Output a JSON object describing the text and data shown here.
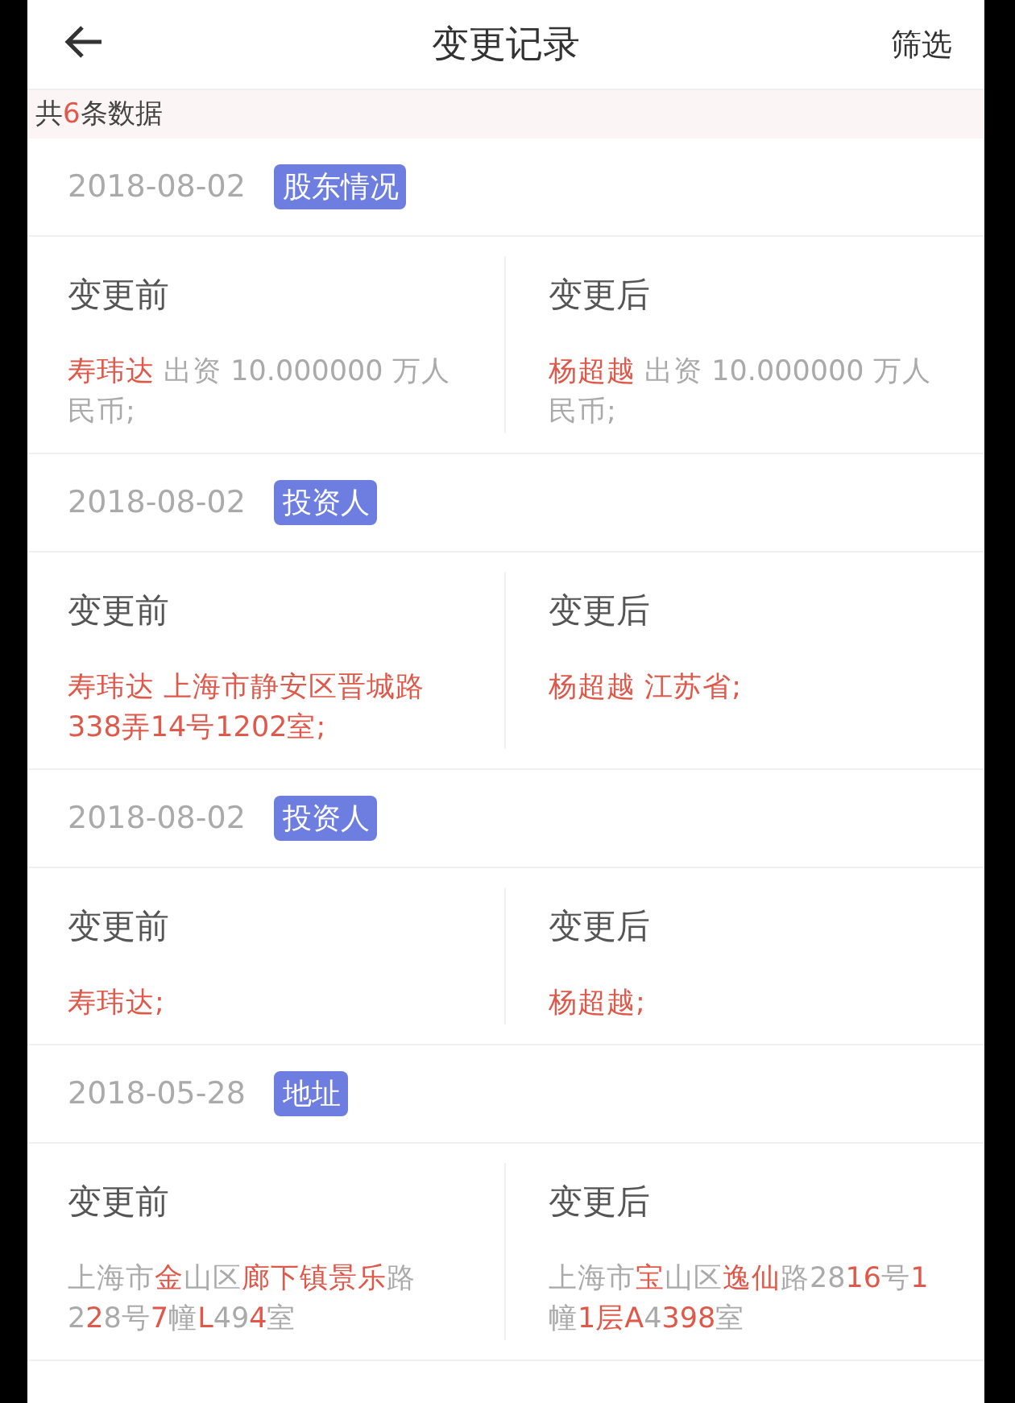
{
  "header": {
    "back_icon": true,
    "title": "变更记录",
    "filter": "筛选"
  },
  "count": [
    {
      "text": "共",
      "highlight": false
    },
    {
      "text": "6",
      "highlight": true
    },
    {
      "text": "条数据",
      "highlight": false
    }
  ],
  "records": [
    {
      "date": "2018-08-02",
      "tag": "股东情况",
      "before_label": "变更前",
      "after_label": "变更后",
      "before": [
        {
          "text": "寿玮达",
          "highlight": true
        },
        {
          "text": " 出资 10.000000 万人民币;",
          "highlight": false
        }
      ],
      "after": [
        {
          "text": "杨超越",
          "highlight": true
        },
        {
          "text": " 出资 10.000000 万人民币;",
          "highlight": false
        }
      ]
    },
    {
      "date": "2018-08-02",
      "tag": "投资人",
      "before_label": "变更前",
      "after_label": "变更后",
      "before": [
        {
          "text": "寿玮达 上海市静安区晋城路338弄14号1202室;",
          "highlight": true
        }
      ],
      "after": [
        {
          "text": "杨超越 江苏省;",
          "highlight": true
        }
      ]
    },
    {
      "date": "2018-08-02",
      "tag": "投资人",
      "before_label": "变更前",
      "after_label": "变更后",
      "before": [
        {
          "text": "寿玮达;",
          "highlight": true
        }
      ],
      "after": [
        {
          "text": "杨超越;",
          "highlight": true
        }
      ]
    },
    {
      "date": "2018-05-28",
      "tag": "地址",
      "before_label": "变更前",
      "after_label": "变更后",
      "before": [
        {
          "text": "上海市",
          "highlight": false
        },
        {
          "text": "金",
          "highlight": true
        },
        {
          "text": "山区",
          "highlight": false
        },
        {
          "text": "廊下镇景乐",
          "highlight": true
        },
        {
          "text": "路2",
          "highlight": false
        },
        {
          "text": "2",
          "highlight": true
        },
        {
          "text": "8号",
          "highlight": false
        },
        {
          "text": "7",
          "highlight": true
        },
        {
          "text": "幢",
          "highlight": false
        },
        {
          "text": "L",
          "highlight": true
        },
        {
          "text": "49",
          "highlight": false
        },
        {
          "text": "4",
          "highlight": true
        },
        {
          "text": "室",
          "highlight": false
        }
      ],
      "after": [
        {
          "text": "上海市",
          "highlight": false
        },
        {
          "text": "宝",
          "highlight": true
        },
        {
          "text": "山区",
          "highlight": false
        },
        {
          "text": "逸仙",
          "highlight": true
        },
        {
          "text": "路28",
          "highlight": false
        },
        {
          "text": "16",
          "highlight": true
        },
        {
          "text": "号",
          "highlight": false
        },
        {
          "text": "1",
          "highlight": true
        },
        {
          "text": "幢",
          "highlight": false
        },
        {
          "text": "1层A",
          "highlight": true
        },
        {
          "text": "4",
          "highlight": false
        },
        {
          "text": "398",
          "highlight": true
        },
        {
          "text": "室",
          "highlight": false
        }
      ]
    }
  ]
}
